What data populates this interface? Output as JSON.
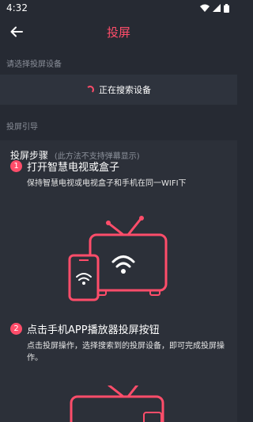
{
  "status": {
    "time": "4:32"
  },
  "header": {
    "title": "投屏"
  },
  "device_section": {
    "label": "请选择投屏设备",
    "searching_text": "正在搜索设备"
  },
  "guide_section": {
    "label": "投屏引导",
    "heading": "投屏步骤",
    "heading_note": "(此方法不支持弹幕显示)",
    "steps": [
      {
        "number": "1",
        "title": "打开智慧电视或盒子",
        "description": "保持智慧电视或电视盒子和手机在同一WIFI下"
      },
      {
        "number": "2",
        "title": "点击手机APP播放器投屏按钮",
        "description": "点击投屏操作，选择搜索到的投屏设备，即可完成投屏操作。"
      }
    ]
  },
  "colors": {
    "accent": "#ff4d6a",
    "background": "#262a33"
  },
  "icons": {
    "back": "back-arrow-icon",
    "wifi": "wifi-icon",
    "battery": "battery-icon"
  }
}
